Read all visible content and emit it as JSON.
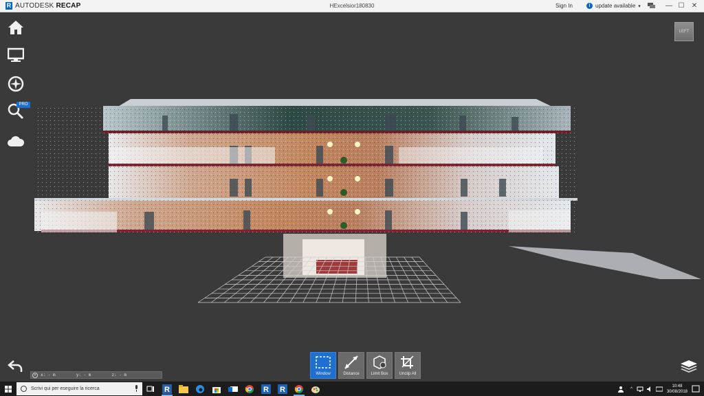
{
  "titlebar": {
    "brand_name": "AUTODESK",
    "brand_product": "RECAP",
    "logo_letter": "R",
    "doc_title": "HExcelsior180830",
    "sign_in": "Sign In",
    "update": "update available",
    "update_icon_text": "i",
    "caret": "▾",
    "minimize": "—",
    "maximize": "☐",
    "close": "✕"
  },
  "left_toolbar": {
    "icons": [
      "home-icon",
      "display-icon",
      "compass-icon",
      "search-icon",
      "cloud-icon"
    ],
    "pro_badge": "PRO"
  },
  "viewcube": {
    "label": "LEFT"
  },
  "coords": {
    "x": "x:  -  m",
    "y": "y:  -  m",
    "z": "z:  -  m",
    "clear_icon": "×"
  },
  "bottom_tools": [
    {
      "label": "Window",
      "icon": "window-select-icon",
      "active": true
    },
    {
      "label": "Distance",
      "icon": "distance-icon",
      "active": false
    },
    {
      "label": "Limit Box",
      "icon": "limit-box-icon",
      "active": false
    },
    {
      "label": "Unclip All",
      "icon": "unclip-icon",
      "active": false
    }
  ],
  "taskbar": {
    "search_placeholder": "Scrivi qui per eseguire la ricerca",
    "time": "10:48",
    "date": "30/08/2018",
    "apps": [
      "recap-icon",
      "file-explorer-icon",
      "edge-icon",
      "store-icon",
      "mail-icon",
      "chrome-icon",
      "revit-icon",
      "revit-icon",
      "chrome-icon",
      "paint-icon"
    ]
  },
  "colors": {
    "accent": "#1f6fd1",
    "viewport_bg": "#3a3a3a",
    "titlebar_bg": "#f3f3f3",
    "taskbar_bg": "#1c1c1c"
  }
}
